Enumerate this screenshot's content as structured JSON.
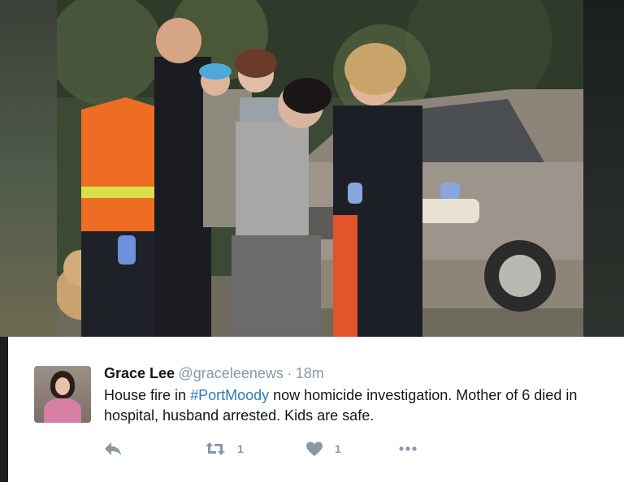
{
  "tweet": {
    "author_name": "Grace Lee",
    "handle": "@graceleenews",
    "separator": "·",
    "time": "18m",
    "text_before": "House fire in ",
    "hashtag": "#PortMoody",
    "text_after": " now homicide investigation. Mother of 6 died in hospital, husband arrested. Kids are safe.",
    "retweet_count": "1",
    "like_count": "1"
  },
  "icons": {
    "reply": "reply-arrow-icon",
    "retweet": "retweet-icon",
    "like": "heart-icon",
    "more": "more-dots-icon"
  },
  "colors": {
    "name": "#14171a",
    "muted": "#8899a6",
    "hashtag": "#2b7bb9",
    "card_bg": "#ffffff"
  }
}
